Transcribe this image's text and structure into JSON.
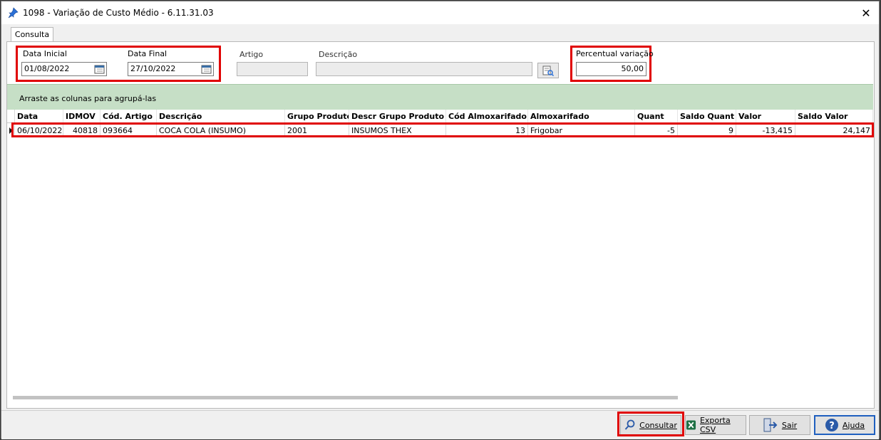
{
  "window": {
    "title": "1098 - Variação de Custo Médio - 6.11.31.03",
    "close_glyph": "✕"
  },
  "tabs": [
    {
      "label": "Consulta",
      "active": true
    }
  ],
  "filters": {
    "data_inicial": {
      "label": "Data Inicial",
      "value": "01/08/2022"
    },
    "data_final": {
      "label": "Data Final",
      "value": "27/10/2022"
    },
    "artigo": {
      "label": "Artigo",
      "value": ""
    },
    "descricao": {
      "label": "Descrição",
      "value": ""
    },
    "percentual": {
      "label": "Percentual variação",
      "value": "50,00"
    }
  },
  "grid": {
    "group_hint": "Arraste as colunas para agrupá-las",
    "columns": [
      "Data",
      "IDMOV",
      "Cód. Artigo",
      "Descrição",
      "Grupo Produto",
      "Descr Grupo Produto",
      "Cód Almoxarifado",
      "Almoxarifado",
      "Quant",
      "Saldo Quant",
      "Valor",
      "Saldo Valor"
    ],
    "rows": [
      [
        "06/10/2022",
        "40818",
        "093664",
        "COCA COLA (INSUMO)",
        "2001",
        "INSUMOS THEX",
        "13",
        "Frigobar",
        "-5",
        "9",
        "-13,415",
        "24,147"
      ]
    ]
  },
  "buttons": {
    "consultar": "Consultar",
    "exporta_csv": "Exporta CSV",
    "sair": "Sair",
    "ajuda": "Ajuda"
  },
  "colors": {
    "highlight": "#e00000",
    "group_bar": "#c6dfc6",
    "focus_border": "#1f5fbf"
  },
  "icons": [
    "pin-icon",
    "close-icon",
    "calendar-icon",
    "lookup-icon",
    "row-indicator-icon",
    "search-icon",
    "excel-icon",
    "exit-icon",
    "help-icon"
  ]
}
